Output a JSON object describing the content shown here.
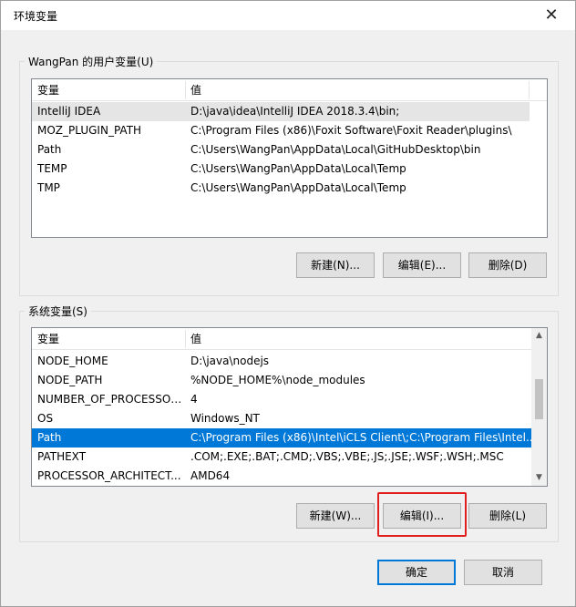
{
  "window": {
    "title": "环境变量",
    "close_glyph": "✕"
  },
  "user_vars": {
    "group_label": "WangPan 的用户变量(U)",
    "col_name": "变量",
    "col_value": "值",
    "rows": [
      {
        "name": "IntelliJ IDEA",
        "value": "D:\\java\\idea\\IntelliJ IDEA 2018.3.4\\bin;"
      },
      {
        "name": "MOZ_PLUGIN_PATH",
        "value": "C:\\Program Files (x86)\\Foxit Software\\Foxit Reader\\plugins\\"
      },
      {
        "name": "Path",
        "value": "C:\\Users\\WangPan\\AppData\\Local\\GitHubDesktop\\bin"
      },
      {
        "name": "TEMP",
        "value": "C:\\Users\\WangPan\\AppData\\Local\\Temp"
      },
      {
        "name": "TMP",
        "value": "C:\\Users\\WangPan\\AppData\\Local\\Temp"
      }
    ],
    "buttons": {
      "new": "新建(N)...",
      "edit": "编辑(E)...",
      "delete": "删除(D)"
    }
  },
  "system_vars": {
    "group_label": "系统变量(S)",
    "col_name": "变量",
    "col_value": "值",
    "rows": [
      {
        "name": "NODE_HOME",
        "value": "D:\\java\\nodejs"
      },
      {
        "name": "NODE_PATH",
        "value": "%NODE_HOME%\\node_modules"
      },
      {
        "name": "NUMBER_OF_PROCESSORS",
        "value": "4"
      },
      {
        "name": "OS",
        "value": "Windows_NT"
      },
      {
        "name": "Path",
        "value": "C:\\Program Files (x86)\\Intel\\iCLS Client\\;C:\\Program Files\\Intel..."
      },
      {
        "name": "PATHEXT",
        "value": ".COM;.EXE;.BAT;.CMD;.VBS;.VBE;.JS;.JSE;.WSF;.WSH;.MSC"
      },
      {
        "name": "PROCESSOR_ARCHITECT...",
        "value": "AMD64"
      }
    ],
    "selected_row": "Path",
    "buttons": {
      "new": "新建(W)...",
      "edit": "编辑(I)...",
      "delete": "删除(L)"
    }
  },
  "footer": {
    "ok": "确定",
    "cancel": "取消"
  },
  "colors": {
    "selection": "#0078d7",
    "highlight_box": "#e0201f",
    "hover_row": "#e5e5e5"
  }
}
